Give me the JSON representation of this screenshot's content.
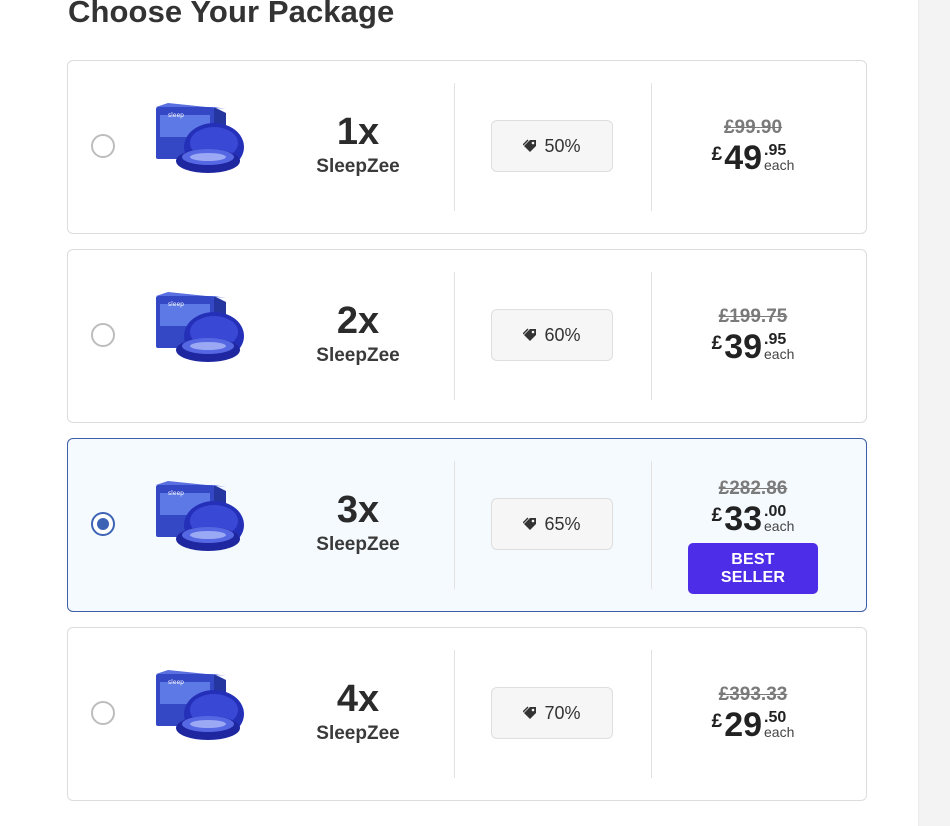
{
  "heading": "Choose Your Package",
  "colors": {
    "selected_border": "#3f5ea8",
    "selected_bg": "#f5fafe",
    "radio_selected": "#3d63b5",
    "badge_bg": "#4e2de8",
    "product_blue": "#2a2fb8"
  },
  "packages": [
    {
      "quantity": "1x",
      "product_name": "SleepZee",
      "discount": "50%",
      "old_price": "£99.90",
      "currency": "£",
      "price_whole": "49",
      "price_cents": ".95",
      "price_unit": "each",
      "selected": false,
      "badge": ""
    },
    {
      "quantity": "2x",
      "product_name": "SleepZee",
      "discount": "60%",
      "old_price": "£199.75",
      "currency": "£",
      "price_whole": "39",
      "price_cents": ".95",
      "price_unit": "each",
      "selected": false,
      "badge": ""
    },
    {
      "quantity": "3x",
      "product_name": "SleepZee",
      "discount": "65%",
      "old_price": "£282.86",
      "currency": "£",
      "price_whole": "33",
      "price_cents": ".00",
      "price_unit": "each",
      "selected": true,
      "badge": "BEST SELLER"
    },
    {
      "quantity": "4x",
      "product_name": "SleepZee",
      "discount": "70%",
      "old_price": "£393.33",
      "currency": "£",
      "price_whole": "29",
      "price_cents": ".50",
      "price_unit": "each",
      "selected": false,
      "badge": ""
    }
  ],
  "icons": {
    "discount": "tag-icon",
    "product": "product-image"
  }
}
